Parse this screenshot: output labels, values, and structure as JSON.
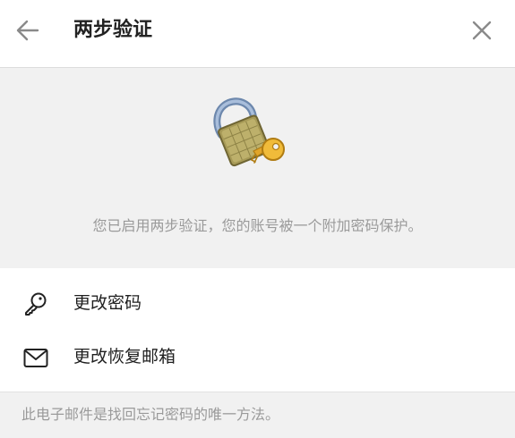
{
  "header": {
    "title": "两步验证",
    "back_icon": "arrow-left-icon",
    "close_icon": "close-icon"
  },
  "hero": {
    "illustration": "padlock-with-key-icon",
    "description": "您已启用两步验证，您的账号被一个附加密码保护。"
  },
  "menu": {
    "items": [
      {
        "icon": "key-icon",
        "label": "更改密码"
      },
      {
        "icon": "envelope-icon",
        "label": "更改恢复邮箱"
      }
    ]
  },
  "footer": {
    "note": "此电子邮件是找回忘记密码的唯一方法。"
  },
  "colors": {
    "background": "#ffffff",
    "panel_gray": "#f1f1f1",
    "muted_text": "#9a9a9a",
    "icon_gray": "#8a8a8a",
    "primary_text": "#222222"
  }
}
